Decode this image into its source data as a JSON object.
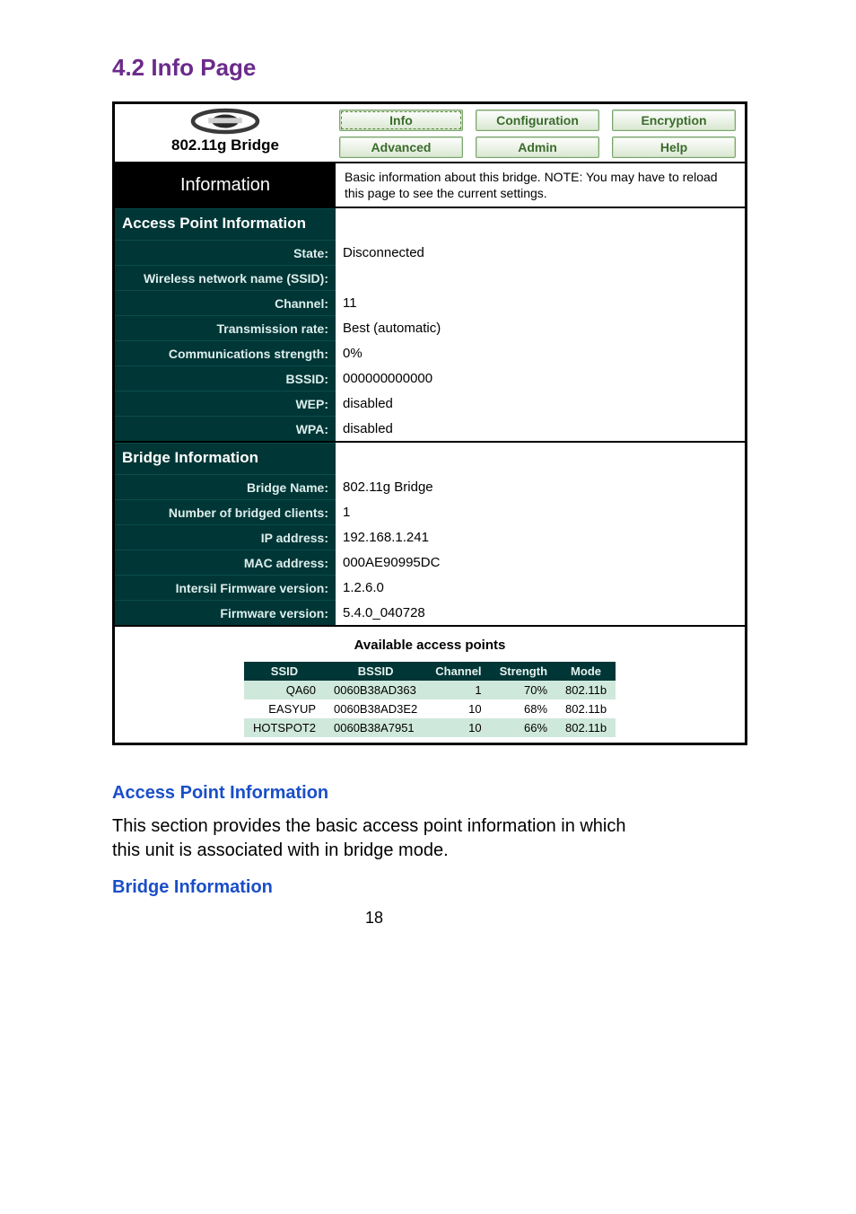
{
  "section_title": "4.2 Info Page",
  "header": {
    "product_name": "802.11g Bridge",
    "tabs_row1": [
      "Info",
      "Configuration",
      "Encryption"
    ],
    "tabs_row2": [
      "Advanced",
      "Admin",
      "Help"
    ],
    "active_tab": "Info"
  },
  "info_bar": {
    "left": "Information",
    "right": "Basic information about this bridge. NOTE: You may have to reload this page to see the current settings."
  },
  "ap_info": {
    "title": "Access Point Information",
    "rows": [
      {
        "k": "State:",
        "v": "Disconnected"
      },
      {
        "k": "Wireless network name (SSID):",
        "v": ""
      },
      {
        "k": "Channel:",
        "v": "11"
      },
      {
        "k": "Transmission rate:",
        "v": "Best (automatic)"
      },
      {
        "k": "Communications strength:",
        "v": "0%"
      },
      {
        "k": "BSSID:",
        "v": "000000000000"
      },
      {
        "k": "WEP:",
        "v": "disabled"
      },
      {
        "k": "WPA:",
        "v": "disabled"
      }
    ]
  },
  "bridge_info": {
    "title": "Bridge Information",
    "rows": [
      {
        "k": "Bridge Name:",
        "v": "802.11g Bridge"
      },
      {
        "k": "Number of bridged clients:",
        "v": "1"
      },
      {
        "k": "IP address:",
        "v": "192.168.1.241"
      },
      {
        "k": "MAC address:",
        "v": "000AE90995DC"
      },
      {
        "k": "Intersil Firmware version:",
        "v": "1.2.6.0"
      },
      {
        "k": "Firmware version:",
        "v": "5.4.0_040728"
      }
    ]
  },
  "aap": {
    "title": "Available access points",
    "headers": [
      "SSID",
      "BSSID",
      "Channel",
      "Strength",
      "Mode"
    ],
    "rows": [
      {
        "ssid": "QA60",
        "bssid": "0060B38AD363",
        "channel": "1",
        "strength": "70%",
        "mode": "802.11b",
        "alt": true
      },
      {
        "ssid": "EASYUP",
        "bssid": "0060B38AD3E2",
        "channel": "10",
        "strength": "68%",
        "mode": "802.11b",
        "alt": false
      },
      {
        "ssid": "HOTSPOT2",
        "bssid": "0060B38A7951",
        "channel": "10",
        "strength": "66%",
        "mode": "802.11b",
        "alt": true
      }
    ]
  },
  "doc": {
    "h_ap": "Access Point Information",
    "p_ap": "This section provides the basic access point information in which this unit is associated with in bridge mode.",
    "h_bridge": "Bridge Information",
    "page_number": "18"
  }
}
